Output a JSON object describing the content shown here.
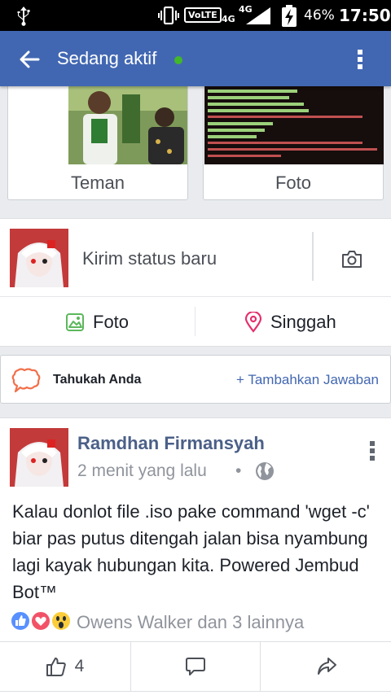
{
  "status_bar": {
    "network_volte": "VoLTE",
    "network_4g_a": "4G",
    "network_4g_b": "4G",
    "battery": "46%",
    "time": "17:50",
    "icons": [
      "usb-icon",
      "vibrate-icon",
      "signal-icon",
      "battery-charging-icon"
    ]
  },
  "header": {
    "title": "Sedang aktif",
    "online_color": "#42b72a",
    "background": "#4267b2",
    "icons": [
      "back-arrow-icon",
      "more-vertical-icon"
    ]
  },
  "shortcuts": {
    "friends_label": "Teman",
    "photos_label": "Foto"
  },
  "composer": {
    "prompt": "Kirim status baru",
    "photo_label": "Foto",
    "checkin_label": "Singgah",
    "icons": [
      "camera-icon",
      "photo-icon",
      "location-pin-icon"
    ]
  },
  "did_you_know": {
    "label": "Tahukah Anda",
    "action": "+ Tambahkan Jawaban",
    "icon": "speech-bubble-icon"
  },
  "post": {
    "author": "Ramdhan Firmansyah",
    "time": "2 menit yang lalu",
    "separator": "•",
    "privacy_icon": "globe-icon",
    "text": "Kalau donlot file .iso pake command 'wget -c' biar pas putus ditengah jalan bisa nyambung lagi kayak hubungan kita. Powered Jembud Bot™",
    "reactions": [
      "like-reaction-icon",
      "love-reaction-icon",
      "wow-reaction-icon"
    ],
    "reaction_names": "Owens Walker dan 3 lainnya",
    "like_count": "4"
  }
}
